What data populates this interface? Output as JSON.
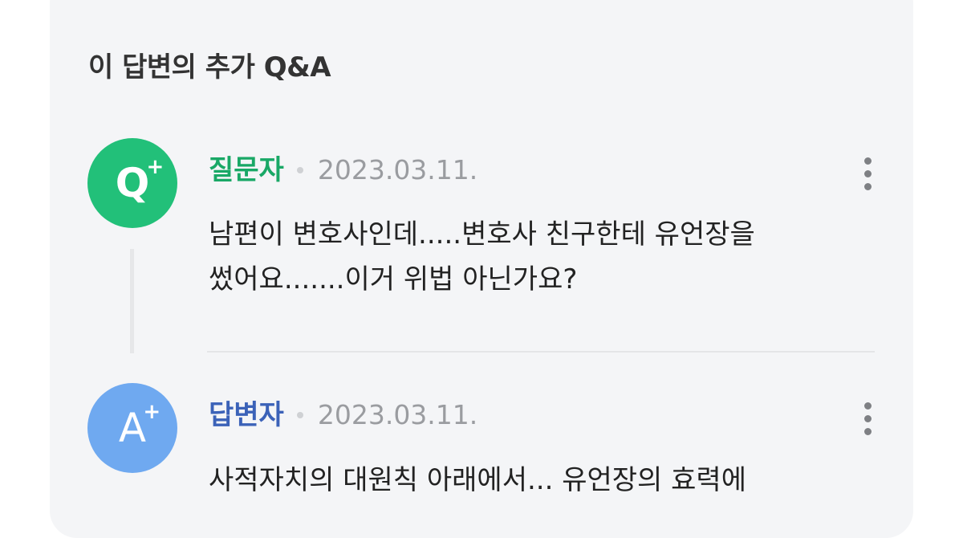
{
  "section": {
    "title": "이 답변의 추가 Q&A"
  },
  "question": {
    "avatar_letter": "Q",
    "avatar_plus": "+",
    "author": "질문자",
    "date": "2023.03.11.",
    "line1": "남편이 변호사인데.....변호사 친구한테 유언장을",
    "line2": "썼어요.......이거 위법 아닌가요?",
    "accent_color": "#22c079"
  },
  "answer": {
    "avatar_letter": "A",
    "avatar_plus": "+",
    "author": "답변자",
    "date": "2023.03.11.",
    "line1": "사적자치의 대원칙 아래에서... 유언장의 효력에",
    "accent_color": "#6fa9f0"
  },
  "icons": {
    "more": "more-vertical-icon"
  }
}
